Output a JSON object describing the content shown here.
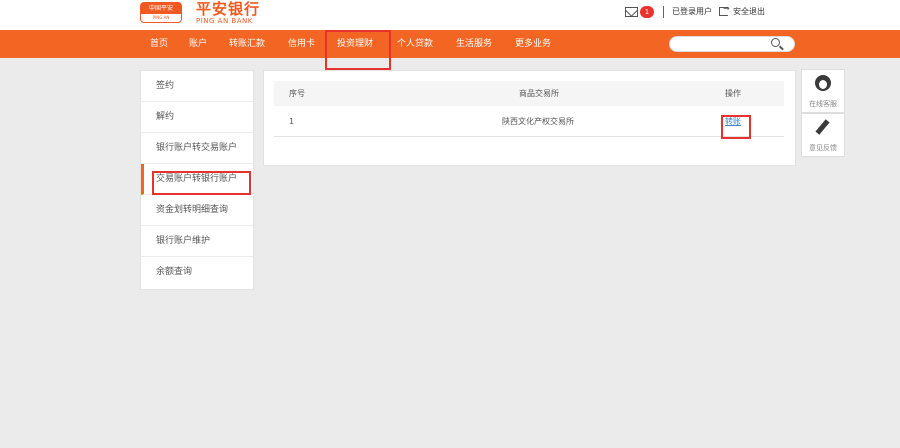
{
  "header": {
    "logo_badge_top": "中国平安",
    "logo_badge_bottom": "PING AN",
    "logo_cn": "平安银行",
    "logo_en": "PING AN BANK",
    "mail_count": "1",
    "login_status": "已登录用户",
    "logout_label": "安全退出"
  },
  "nav": {
    "items": [
      "首页",
      "账户",
      "转账汇款",
      "信用卡",
      "投资理财",
      "个人贷款",
      "生活服务",
      "更多业务"
    ],
    "active_index": 4,
    "search_placeholder": ""
  },
  "sidebar": {
    "items": [
      "签约",
      "解约",
      "银行账户转交易账户",
      "交易账户转银行账户",
      "资金划转明细查询",
      "银行账户维护",
      "余额查询"
    ],
    "active_index": 3
  },
  "table": {
    "headers": [
      "序号",
      "商品交易所",
      "操作"
    ],
    "rows": [
      {
        "index": "1",
        "exchange": "陕西文化产权交易所",
        "action": "转账"
      }
    ]
  },
  "tools": {
    "service_label": "在线客服",
    "feedback_label": "意见反馈"
  },
  "colors": {
    "brand": "#f26522",
    "highlight": "#e8322d",
    "link": "#3a7fc8"
  }
}
